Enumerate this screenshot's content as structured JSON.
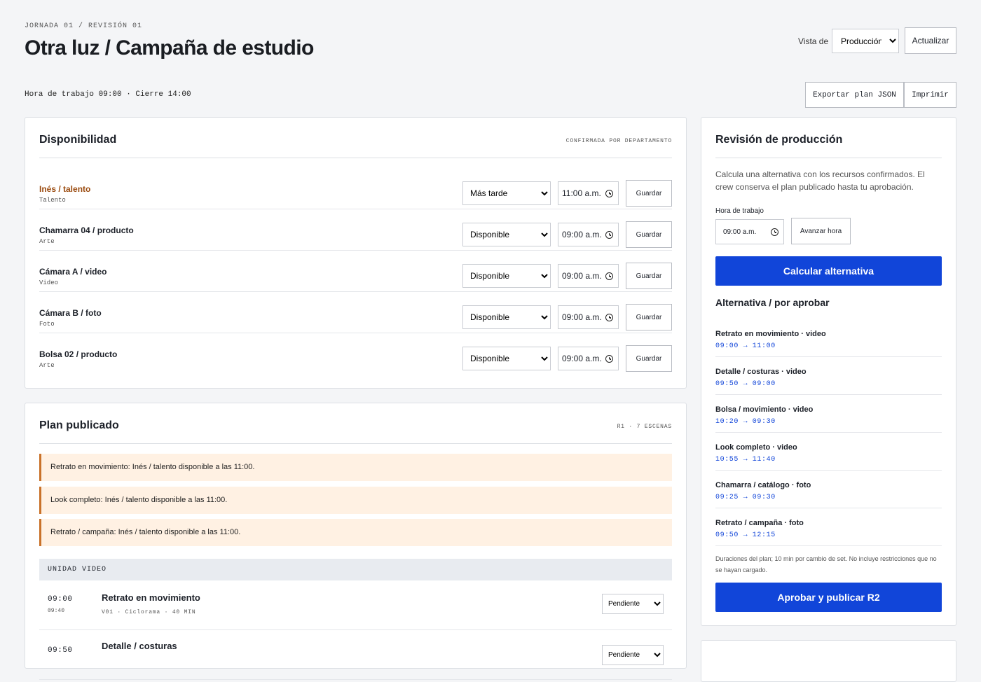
{
  "header": {
    "kicker": "JORNADA 01 / REVISIÓN 01",
    "title": "Otra luz / Campaña de estudio",
    "view_label": "Vista de",
    "view_selected": "Producción",
    "refresh_label": "Actualizar",
    "hours": "Hora de trabajo 09:00 · Cierre 14:00",
    "export_label": "Exportar plan JSON",
    "print_label": "Imprimir"
  },
  "availability": {
    "title": "Disponibilidad",
    "meta": "CONFIRMADA POR DEPARTAMENTO",
    "save_label": "Guardar",
    "rows": [
      {
        "name": "Inés / talento",
        "dept": "Talento",
        "status": "Más tarde",
        "time": "11:00 a.m.",
        "warn": true
      },
      {
        "name": "Chamarra 04 / producto",
        "dept": "Arte",
        "status": "Disponible",
        "time": "09:00 a.m."
      },
      {
        "name": "Cámara A / video",
        "dept": "Video",
        "status": "Disponible",
        "time": "09:00 a.m."
      },
      {
        "name": "Cámara B / foto",
        "dept": "Foto",
        "status": "Disponible",
        "time": "09:00 a.m."
      },
      {
        "name": "Bolsa 02 / producto",
        "dept": "Arte",
        "status": "Disponible",
        "time": "09:00 a.m."
      }
    ]
  },
  "plan": {
    "title": "Plan publicado",
    "meta": "R1 · 7 ESCENAS",
    "alerts": [
      "Retrato en movimiento: Inés / talento disponible a las 11:00.",
      "Look completo: Inés / talento disponible a las 11:00.",
      "Retrato / campaña: Inés / talento disponible a las 11:00."
    ],
    "unit_label": "UNIDAD VIDEO",
    "scenes": [
      {
        "start": "09:00",
        "end": "09:40",
        "name": "Retrato en movimiento",
        "meta": "V01 · Ciclorama · 40 MIN",
        "status": "Pendiente"
      },
      {
        "start": "09:50",
        "end": "",
        "name": "Detalle / costuras",
        "meta": "",
        "status": "Pendiente"
      }
    ]
  },
  "review": {
    "title": "Revisión de producción",
    "description": "Calcula una alternativa con los recursos confirmados. El crew conserva el plan publicado hasta tu aprobación.",
    "field_label": "Hora de trabajo",
    "time_value": "09:00 a.m.",
    "advance_label": "Avanzar hora",
    "calculate_label": "Calcular alternativa",
    "alt_title": "Alternativa / por aprobar",
    "alternatives": [
      {
        "name": "Retrato en movimiento · video",
        "times": "09:00 → 11:00"
      },
      {
        "name": "Detalle / costuras · video",
        "times": "09:50 → 09:00"
      },
      {
        "name": "Bolsa / movimiento · video",
        "times": "10:20 → 09:30"
      },
      {
        "name": "Look completo · video",
        "times": "10:55 → 11:40"
      },
      {
        "name": "Chamarra / catálogo · foto",
        "times": "09:25 → 09:30"
      },
      {
        "name": "Retrato / campaña · foto",
        "times": "09:50 → 12:15"
      }
    ],
    "note": "Duraciones del plan; 10 min por cambio de set. No incluye restricciones que no se hayan cargado.",
    "approve_label": "Aprobar y publicar R2"
  },
  "colors": {
    "accent": "#1145d9",
    "warning_text": "#9a4a0e",
    "alert_bg": "#fff1e3",
    "alert_border": "#c9722a"
  }
}
